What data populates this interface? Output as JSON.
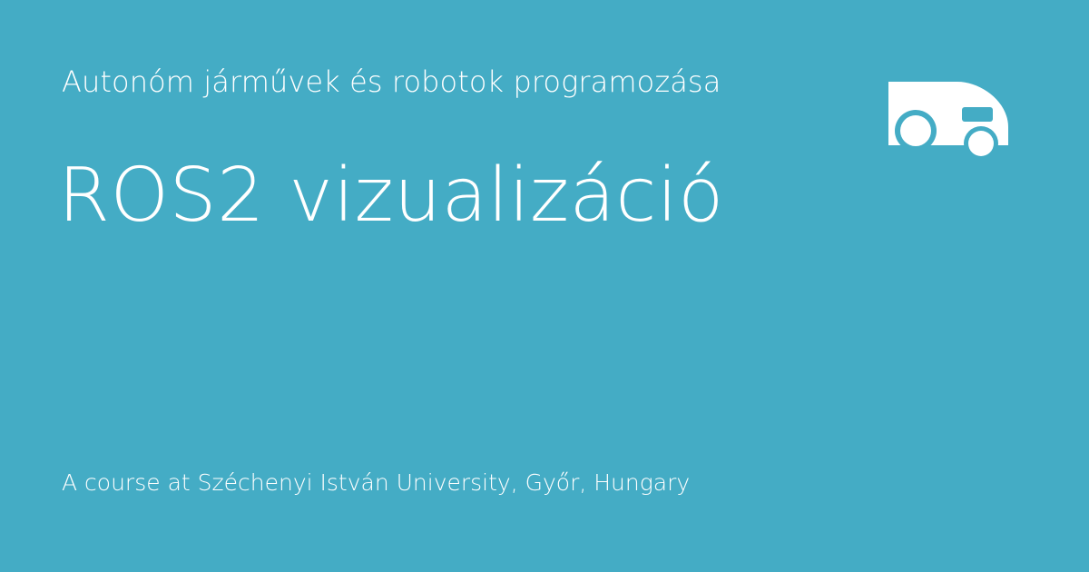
{
  "course_title": "Autonóm járművek és robotok programozása",
  "lesson_title": "ROS2 vizualizáció",
  "footer_text": "A course at Széchenyi István University, Győr, Hungary",
  "colors": {
    "background": "#44acc5",
    "foreground": "#ffffff"
  },
  "icons": {
    "logo": "vehicle-icon"
  }
}
